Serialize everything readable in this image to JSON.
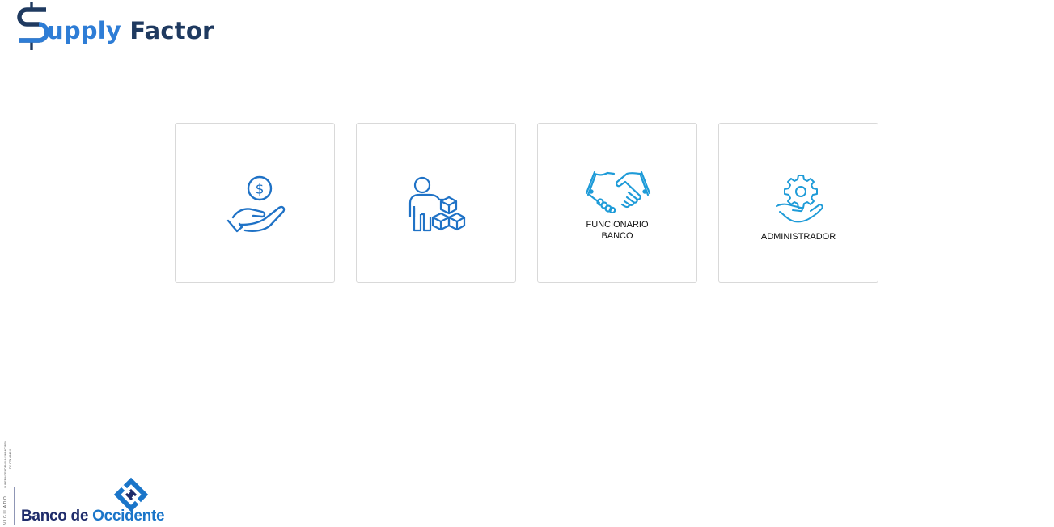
{
  "header": {
    "brand_word1": "upply",
    "brand_word2": "Factor"
  },
  "cards": [
    {
      "icon": "hand-coin-icon",
      "label": ""
    },
    {
      "icon": "person-boxes-icon",
      "label": ""
    },
    {
      "icon": "handshake-icon",
      "label": "FUNCIONARIO\nBANCO"
    },
    {
      "icon": "gear-hand-icon",
      "label": "ADMINISTRADOR"
    }
  ],
  "footer": {
    "vigilado": "VIGILADO",
    "superintendencia": "SUPERINTENDENCIA FINANCIERA",
    "de_colombia": "DE COLOMBIA",
    "bank_name_1": "Banco de",
    "bank_name_2": "Occidente"
  },
  "colors": {
    "icon_blue": "#1f72c6",
    "icon_light": "#1e9bd8",
    "brand_light": "#2e7dd6",
    "brand_dark": "#1f3a60"
  }
}
